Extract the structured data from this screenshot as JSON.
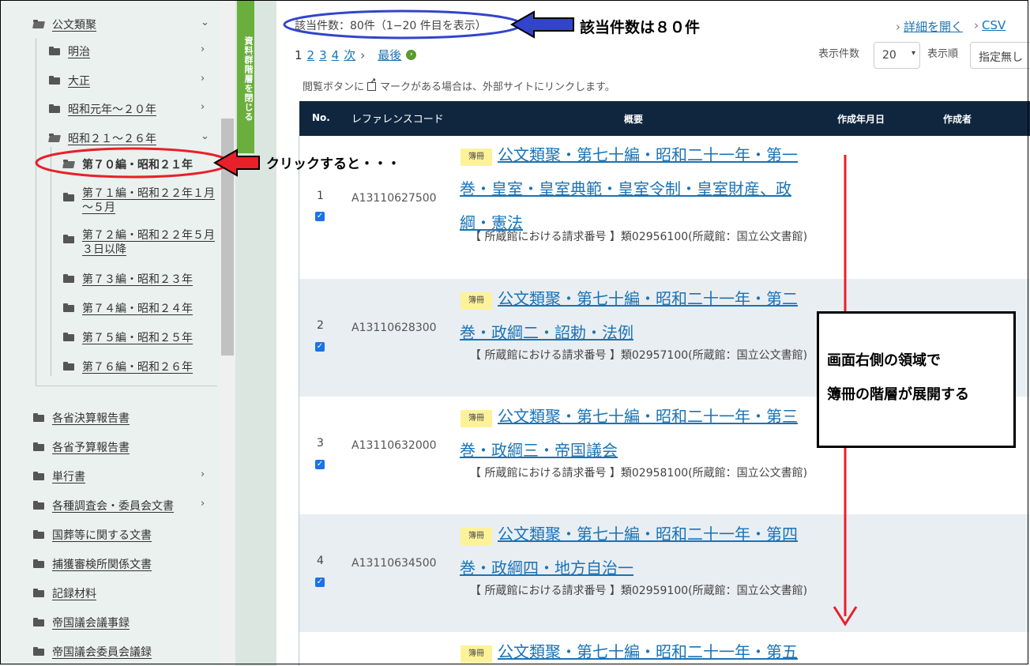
{
  "sidebar": {
    "collapse_tab": "資料群階層を閉じる",
    "items": [
      {
        "label": "公文類聚"
      },
      {
        "label": "明治"
      },
      {
        "label": "大正"
      },
      {
        "label": "昭和元年～２０年"
      },
      {
        "label": "昭和２１～２６年"
      },
      {
        "label": "第７０編・昭和２１年"
      },
      {
        "label": "第７１編・昭和２２年１月～５月"
      },
      {
        "label": "第７２編・昭和２２年５月３日以降"
      },
      {
        "label": "第７３編・昭和２３年"
      },
      {
        "label": "第７４編・昭和２４年"
      },
      {
        "label": "第７５編・昭和２５年"
      },
      {
        "label": "第７６編・昭和２６年"
      },
      {
        "label": "各省決算報告書"
      },
      {
        "label": "各省予算報告書"
      },
      {
        "label": "単行書"
      },
      {
        "label": "各種調査会・委員会文書"
      },
      {
        "label": "国葬等に関する文書"
      },
      {
        "label": "捕獲審検所関係文書"
      },
      {
        "label": "記録材料"
      },
      {
        "label": "帝国議会議事録"
      },
      {
        "label": "帝国議会委員会議録"
      }
    ]
  },
  "results": {
    "count_text": "該当件数：80件（1−20 件目を表示）",
    "pager": {
      "p1": "1",
      "p2": "2",
      "p3": "3",
      "p4": "4",
      "next": "次",
      "last": "最後"
    },
    "links": {
      "details": "詳細を開く",
      "csv": "CSV"
    },
    "display_count_label": "表示件数",
    "display_count_value": "20",
    "sort_label": "表示順",
    "sort_value": "指定無し",
    "note_before": "閲覧ボタンに",
    "note_after": "マークがある場合は、外部サイトにリンクします。"
  },
  "table": {
    "headers": {
      "no": "No.",
      "ref": "レファレンスコード",
      "summary": "概要",
      "date": "作成年月日",
      "author": "作成者"
    },
    "rows": [
      {
        "no": "1",
        "ref": "A13110627500",
        "badge": "簿冊",
        "title": "公文類聚・第七十編・昭和二十一年・第一巻・皇室・皇室典範・皇室令制・皇室財産、政綱・憲法",
        "req": "【 所蔵館における請求番号 】類02956100(所蔵館：国立公文書館)"
      },
      {
        "no": "2",
        "ref": "A13110628300",
        "badge": "簿冊",
        "title": "公文類聚・第七十編・昭和二十一年・第二巻・政綱二・詔勅・法例",
        "req": "【 所蔵館における請求番号 】類02957100(所蔵館：国立公文書館)"
      },
      {
        "no": "3",
        "ref": "A13110632000",
        "badge": "簿冊",
        "title": "公文類聚・第七十編・昭和二十一年・第三巻・政綱三・帝国議会",
        "req": "【 所蔵館における請求番号 】類02958100(所蔵館：国立公文書館)"
      },
      {
        "no": "4",
        "ref": "A13110634500",
        "badge": "簿冊",
        "title": "公文類聚・第七十編・昭和二十一年・第四巻・政綱四・地方自治一",
        "req": "【 所蔵館における請求番号 】類02959100(所蔵館：国立公文書館)"
      },
      {
        "no": "",
        "ref": "",
        "badge": "簿冊",
        "title": "公文類聚・第七十編・昭和二十一年・第五",
        "req": ""
      }
    ]
  },
  "annotations": {
    "count": "該当件数は８０件",
    "click": "クリックすると・・・",
    "box_line1": "画面右側の領域で",
    "box_line2": "簿冊の階層が展開する"
  },
  "colors": {
    "header_bg": "#10263f",
    "link": "#1a73b5",
    "collapse_tab": "#6aaf3e",
    "annotation_red": "#e8202a",
    "annotation_blue": "#3344cc"
  }
}
